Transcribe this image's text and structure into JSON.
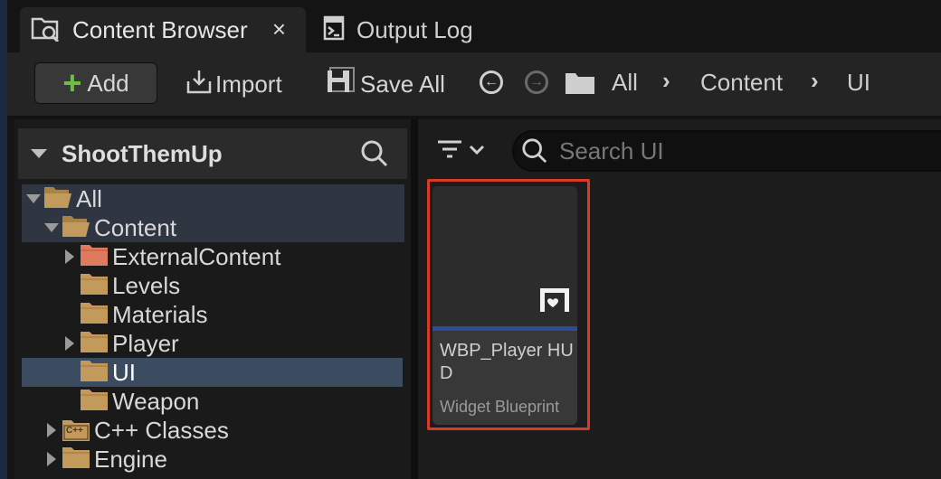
{
  "tabs": [
    {
      "label": "Content Browser",
      "active": true,
      "close_icon": "×"
    },
    {
      "label": "Output Log",
      "active": false
    }
  ],
  "toolbar": {
    "add_label": "Add",
    "import_label": "Import",
    "save_all_label": "Save All",
    "breadcrumbs": [
      "All",
      "Content",
      "UI"
    ]
  },
  "sources_panel": {
    "title": "ShootThemUp",
    "tree": [
      {
        "label": "All",
        "depth": 0,
        "expander": "expanded",
        "icon": "open-folder-icon",
        "highlight": true
      },
      {
        "label": "Content",
        "depth": 1,
        "expander": "expanded",
        "icon": "open-folder-icon",
        "highlight": true
      },
      {
        "label": "ExternalContent",
        "depth": 2,
        "expander": "collapsed",
        "icon": "external-folder-icon"
      },
      {
        "label": "Levels",
        "depth": 2,
        "expander": "none",
        "icon": "folder-icon"
      },
      {
        "label": "Materials",
        "depth": 2,
        "expander": "none",
        "icon": "folder-icon"
      },
      {
        "label": "Player",
        "depth": 2,
        "expander": "collapsed",
        "icon": "folder-icon"
      },
      {
        "label": "UI",
        "depth": 2,
        "expander": "none",
        "icon": "folder-icon",
        "selected": true
      },
      {
        "label": "Weapon",
        "depth": 2,
        "expander": "none",
        "icon": "folder-icon"
      },
      {
        "label": "C++ Classes",
        "depth": 1,
        "expander": "collapsed",
        "icon": "cpp-folder-icon",
        "icon_text": "C++"
      },
      {
        "label": "Engine",
        "depth": 1,
        "expander": "collapsed",
        "icon": "folder-icon"
      }
    ]
  },
  "content_panel": {
    "search_placeholder": "Search UI",
    "assets": [
      {
        "name": "WBP_Player HUD",
        "type": "Widget Blueprint",
        "type_color": "#2e4b96",
        "selected": true
      }
    ]
  },
  "colors": {
    "add_plus": "#6cbe45",
    "selection_outline": "#d83a25",
    "folder": "#c29a5b",
    "external_folder": "#e07a5f",
    "selected_row": "#3b4b60"
  }
}
